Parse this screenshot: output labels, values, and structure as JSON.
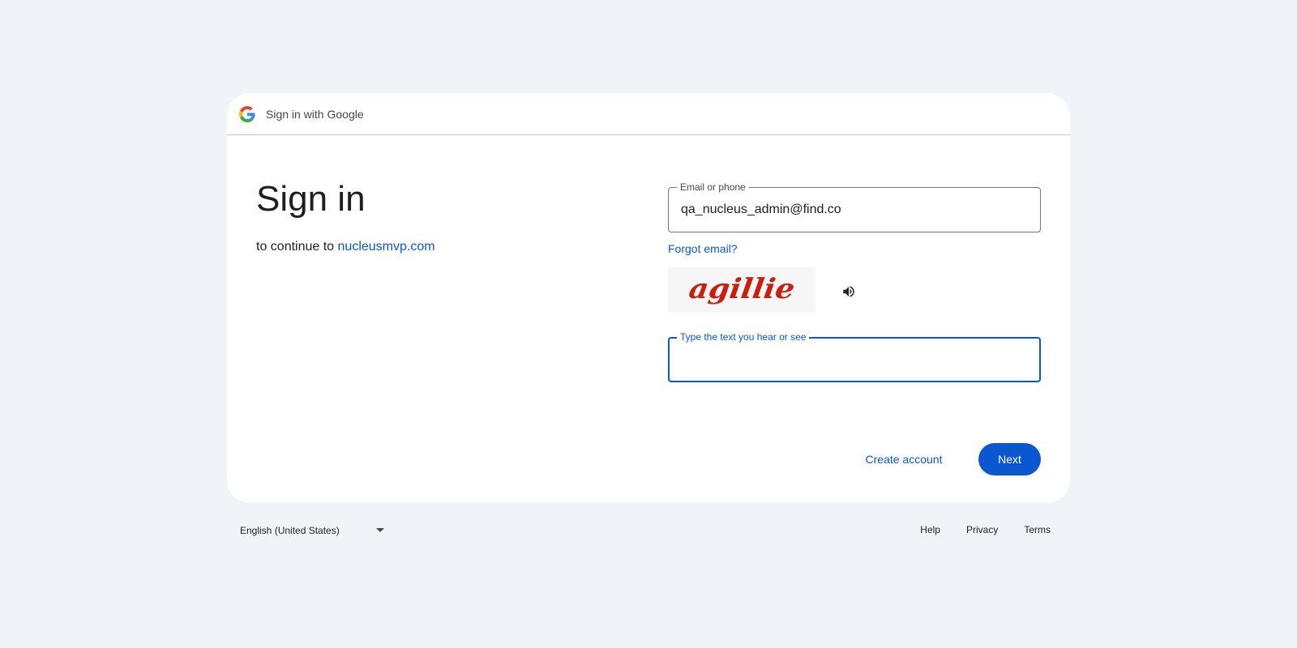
{
  "header": {
    "title": "Sign in with Google"
  },
  "main": {
    "title": "Sign in",
    "subtitle_prefix": "to continue to ",
    "subtitle_link": "nucleusmvp.com"
  },
  "email_field": {
    "label": "Email or phone",
    "value": "qa_nucleus_admin@find.co"
  },
  "forgot_email": "Forgot email?",
  "captcha": {
    "image_text": "agillie",
    "text_color": "#c8200e",
    "field_label": "Type the text you hear or see",
    "value": ""
  },
  "actions": {
    "create_account": "Create account",
    "next": "Next"
  },
  "footer": {
    "language": "English (United States)",
    "links": [
      "Help",
      "Privacy",
      "Terms"
    ]
  },
  "colors": {
    "background": "#f0f4f9",
    "accent": "#0b57d0",
    "text": "#1f1f1f"
  }
}
